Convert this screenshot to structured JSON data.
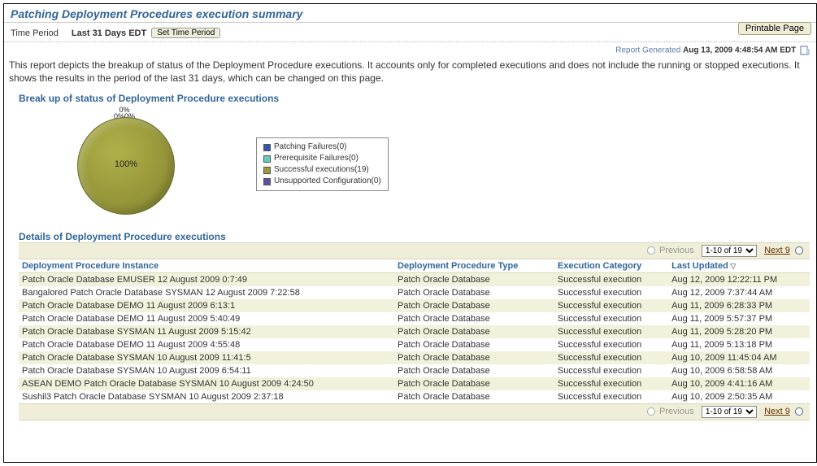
{
  "page_title": "Patching Deployment Procedures execution summary",
  "printable_label": "Printable Page",
  "time_period": {
    "label": "Time Period",
    "value": "Last 31 Days EDT",
    "set_button": "Set Time Period"
  },
  "report_generated": {
    "label": "Report Generated",
    "value": "Aug 13, 2009 4:48:54 AM EDT"
  },
  "description": "This report depicts the breakup of status of the Deployment Procedure executions. It accounts only for completed executions and does not include the running or stopped executions. It shows the results in the period of the last 31 days, which can be changed on this page.",
  "section_breakup": "Break up of status of Deployment Procedure executions",
  "section_details": "Details of Deployment Procedure executions",
  "chart_data": {
    "type": "pie",
    "title": "",
    "series": [
      {
        "name": "Patching Failures",
        "value": 0,
        "color": "#3355aa"
      },
      {
        "name": "Prerequisite Failures",
        "value": 0,
        "color": "#66ccbb"
      },
      {
        "name": "Successful executions",
        "value": 19,
        "color": "#9a9a3a"
      },
      {
        "name": "Unsupported Configuration",
        "value": 0,
        "color": "#6050a0"
      }
    ],
    "center_label": "100%",
    "tiny_labels": [
      "0%",
      "0%",
      "0%"
    ]
  },
  "legend_labels": [
    "Patching Failures(0)",
    "Prerequisite Failures(0)",
    "Successful executions(19)",
    "Unsupported Configuration(0)"
  ],
  "pager": {
    "previous": "Previous",
    "range": "1-10 of 19",
    "next": "Next 9"
  },
  "columns": {
    "c1": "Deployment Procedure Instance",
    "c2": "Deployment Procedure Type",
    "c3": "Execution Category",
    "c4": "Last Updated"
  },
  "rows": [
    {
      "c1": "Patch Oracle Database EMUSER 12 August 2009 0:7:49",
      "c2": "Patch Oracle Database",
      "c3": "Successful execution",
      "c4": "Aug 12, 2009 12:22:11 PM"
    },
    {
      "c1": "Bangalored Patch Oracle Database SYSMAN 12 August 2009 7:22:58",
      "c2": "Patch Oracle Database",
      "c3": "Successful execution",
      "c4": "Aug 12, 2009 7:37:44 AM"
    },
    {
      "c1": "Patch Oracle Database DEMO 11 August 2009 6:13:1",
      "c2": "Patch Oracle Database",
      "c3": "Successful execution",
      "c4": "Aug 11, 2009 6:28:33 PM"
    },
    {
      "c1": "Patch Oracle Database DEMO 11 August 2009 5:40:49",
      "c2": "Patch Oracle Database",
      "c3": "Successful execution",
      "c4": "Aug 11, 2009 5:57:37 PM"
    },
    {
      "c1": "Patch Oracle Database SYSMAN 11 August 2009 5:15:42",
      "c2": "Patch Oracle Database",
      "c3": "Successful execution",
      "c4": "Aug 11, 2009 5:28:20 PM"
    },
    {
      "c1": "Patch Oracle Database DEMO 11 August 2009 4:55:48",
      "c2": "Patch Oracle Database",
      "c3": "Successful execution",
      "c4": "Aug 11, 2009 5:13:18 PM"
    },
    {
      "c1": "Patch Oracle Database SYSMAN 10 August 2009 11:41:5",
      "c2": "Patch Oracle Database",
      "c3": "Successful execution",
      "c4": "Aug 10, 2009 11:45:04 AM"
    },
    {
      "c1": "Patch Oracle Database SYSMAN 10 August 2009 6:54:11",
      "c2": "Patch Oracle Database",
      "c3": "Successful execution",
      "c4": "Aug 10, 2009 6:58:58 AM"
    },
    {
      "c1": "ASEAN DEMO Patch Oracle Database SYSMAN 10 August 2009 4:24:50",
      "c2": "Patch Oracle Database",
      "c3": "Successful execution",
      "c4": "Aug 10, 2009 4:41:16 AM"
    },
    {
      "c1": "Sushil3 Patch Oracle Database SYSMAN 10 August 2009 2:37:18",
      "c2": "Patch Oracle Database",
      "c3": "Successful execution",
      "c4": "Aug 10, 2009 2:50:35 AM"
    }
  ]
}
